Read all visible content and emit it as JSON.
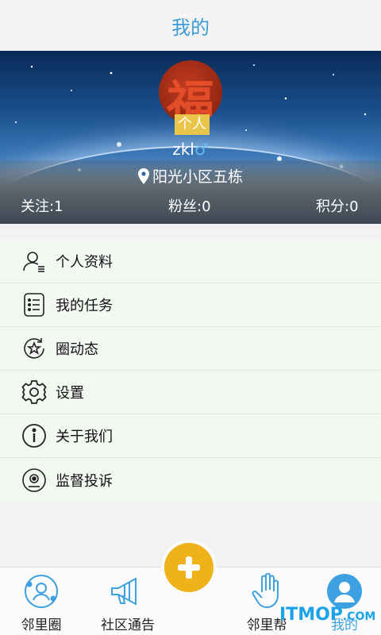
{
  "header": {
    "title": "我的"
  },
  "profile": {
    "role_badge": "个人",
    "username": "zkl",
    "gender_symbol": "♂",
    "location": "阳光小区五栋",
    "stats": {
      "following": "关注:1",
      "fans": "粉丝:0",
      "points": "积分:0"
    }
  },
  "menu": {
    "items": [
      {
        "label": "个人资料",
        "icon": "profile-icon"
      },
      {
        "label": "我的任务",
        "icon": "task-list-icon"
      },
      {
        "label": "圈动态",
        "icon": "star-refresh-icon"
      },
      {
        "label": "设置",
        "icon": "gear-icon"
      },
      {
        "label": "关于我们",
        "icon": "info-icon"
      },
      {
        "label": "监督投诉",
        "icon": "camera-icon"
      }
    ]
  },
  "tabbar": {
    "tabs": [
      {
        "label": "邻里圈",
        "icon": "circle-user-icon"
      },
      {
        "label": "社区通告",
        "icon": "megaphone-icon"
      },
      {
        "label": "邻里帮",
        "icon": "hand-icon"
      },
      {
        "label": "我的",
        "icon": "person-icon"
      }
    ],
    "center_button_icon": "plus-icon"
  },
  "watermark": {
    "text": "ITMOP",
    "suffix": ".COM"
  },
  "colors": {
    "accent": "#3d9bd6",
    "fab": "#f0b21a",
    "badge": "#e9c64a"
  }
}
